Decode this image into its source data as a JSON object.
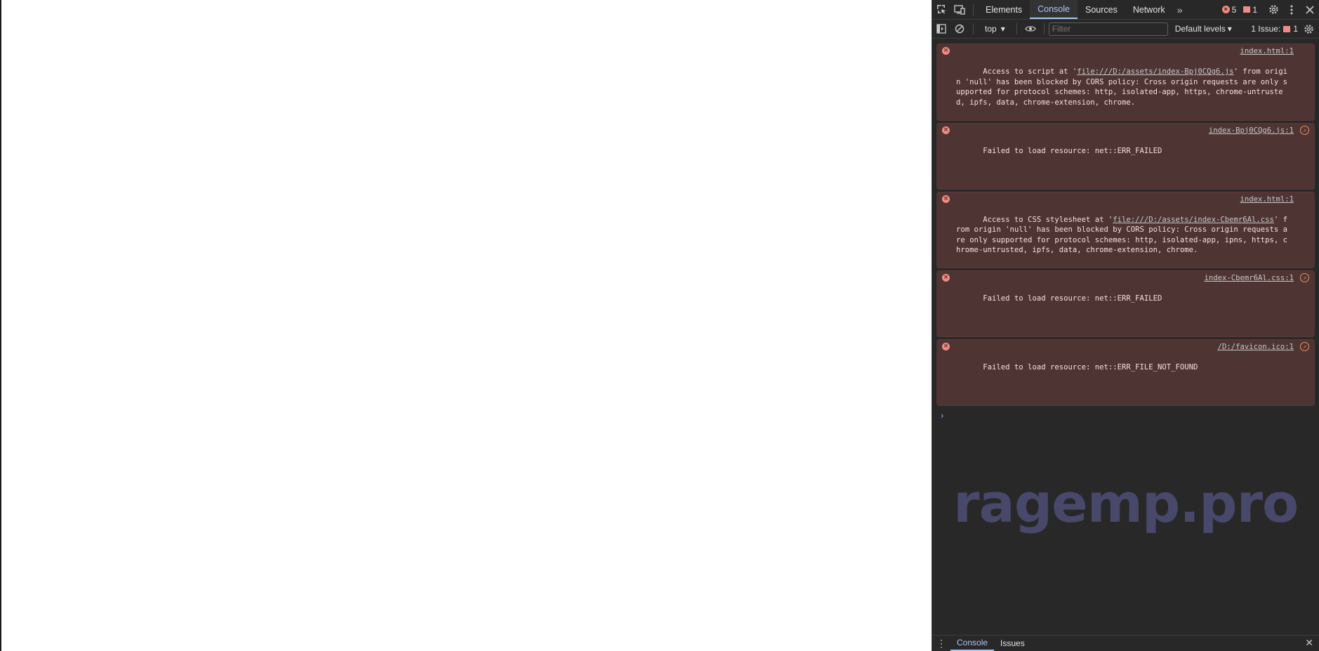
{
  "devtools": {
    "tabs": [
      "Elements",
      "Console",
      "Sources",
      "Network"
    ],
    "active_tab": "Console",
    "error_count": "5",
    "issue_flag_count": "1",
    "toolbar": {
      "context": "top",
      "filter_placeholder": "Filter",
      "levels": "Default levels",
      "issues_label": "1 Issue:",
      "issues_count": "1"
    },
    "messages": [
      {
        "pre": "Access to script at '",
        "link": "file:///D:/assets/index-Bpj0CQg6.js",
        "post": "' from origin 'null' has been blocked by CORS policy: Cross origin requests are only supported for protocol schemes: http, isolated-app, https, chrome-untrusted, ipfs, data, chrome-extension, chrome.",
        "source": "index.html:1"
      },
      {
        "text": "Failed to load resource: net::ERR_FAILED",
        "source": "index-Bpj0CQg6.js:1"
      },
      {
        "pre": "Access to CSS stylesheet at '",
        "link": "file:///D:/assets/index-Cbemr6Al.css",
        "post": "' from origin 'null' has been blocked by CORS policy: Cross origin requests are only supported for protocol schemes: http, isolated-app, ipns, https, chrome-untrusted, ipfs, data, chrome-extension, chrome.",
        "source": "index.html:1"
      },
      {
        "text": "Failed to load resource: net::ERR_FAILED",
        "source": "index-Cbemr6Al.css:1"
      },
      {
        "text": "Failed to load resource: net::ERR_FILE_NOT_FOUND",
        "source": "/D:/favicon.ico:1"
      }
    ],
    "drawer_tabs": [
      "Console",
      "Issues"
    ],
    "drawer_active": "Console"
  },
  "watermark": "ragemp.pro",
  "colors": {
    "panel_bg": "#282828",
    "error_bg": "#4e3534",
    "error_icon": "#f28b82",
    "accent": "#a8c7fa"
  }
}
